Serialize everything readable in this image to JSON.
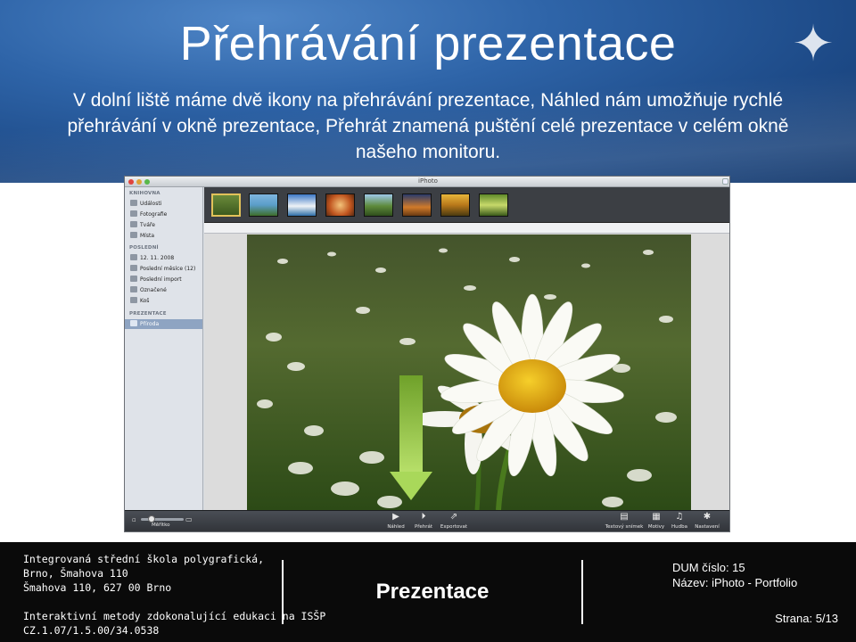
{
  "slide": {
    "title": "Přehrávání prezentace",
    "subtitle": "V dolní liště máme dvě ikony na přehrávání prezentace, Náhled nám umožňuje rychlé přehrávání v okně prezentace, Přehrát znamená puštění celé prezentace v celém okně našeho monitoru."
  },
  "app": {
    "window_title": "iPhoto",
    "sidebar": {
      "library_header": "KNIHOVNA",
      "library_items": [
        "Události",
        "Fotografie",
        "Tváře",
        "Místa"
      ],
      "recent_header": "POSLEDNÍ",
      "recent_items": [
        "12. 11. 2008",
        "Poslední měsíce (12)",
        "Poslední import",
        "Označené",
        "Koš"
      ],
      "slideshow_header": "PREZENTACE",
      "slideshow_items": [
        "Příroda"
      ]
    },
    "toolbar": {
      "zoom_label": "Měřítko",
      "preview_label": "Náhled",
      "play_label": "Přehrát",
      "export_label": "Exportovat",
      "text_slide_label": "Textový snímek",
      "themes_label": "Motivy",
      "music_label": "Hudba",
      "settings_label": "Nastavení"
    }
  },
  "footer": {
    "school_line1": "Integrovaná střední škola polygrafická,",
    "school_line2": "Brno, Šmahova 110",
    "school_line3": "Šmahova 110, 627 00 Brno",
    "project_line1": "Interaktivní metody zdokonalující edukaci na ISŠP",
    "project_line2": "CZ.1.07/1.5.00/34.0538",
    "center_title": "Prezentace",
    "dum_number": "DUM číslo: 15",
    "dum_name": "Název: iPhoto - Portfolio",
    "page": "Strana: 5/13"
  },
  "colors": {
    "header_blue": "#2e64a8",
    "footer_black": "#0a0a0a",
    "arrow_green": "#8fc33a",
    "selection_blue": "#8ea4c2"
  }
}
